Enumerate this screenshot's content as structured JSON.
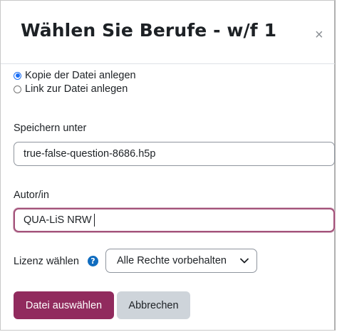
{
  "dialog": {
    "title": "Wählen Sie Berufe - w/f 1",
    "close_label": "×"
  },
  "options": {
    "copy_label": "Kopie der Datei anlegen",
    "copy_selected": true,
    "link_label": "Link zur Datei anlegen",
    "link_selected": false
  },
  "save_as": {
    "label": "Speichern unter",
    "value": "true-false-question-8686.h5p"
  },
  "author": {
    "label": "Autor/in",
    "value": "QUA-LiS NRW"
  },
  "license": {
    "label": "Lizenz wählen",
    "help_icon": "question-circle-icon",
    "help_glyph": "?",
    "selected": "Alle Rechte vorbehalten"
  },
  "buttons": {
    "select_file": "Datei auswählen",
    "cancel": "Abbrechen"
  },
  "colors": {
    "primary": "#912b5e",
    "secondary": "#ced4da",
    "focus_ring": "#a3527a",
    "radio_accent": "#1a6ef5",
    "help_icon": "#0f6cbf"
  }
}
